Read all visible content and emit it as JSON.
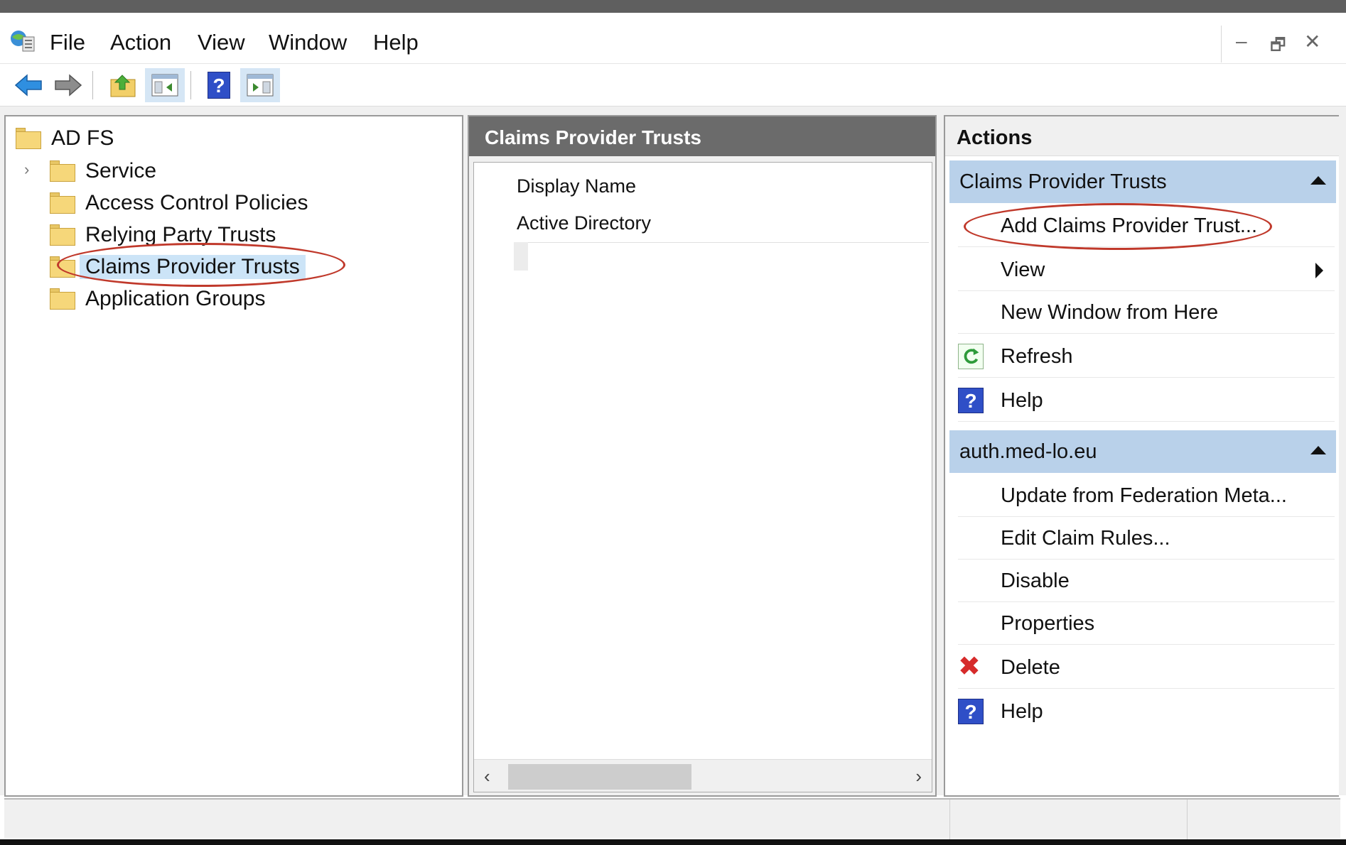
{
  "menu": {
    "items": [
      "File",
      "Action",
      "View",
      "Window",
      "Help"
    ]
  },
  "window_controls": {
    "minimize": "–",
    "restore": "🗗",
    "close": "✕"
  },
  "tree": {
    "root": "AD FS",
    "items": [
      {
        "label": "Service",
        "expandable": true
      },
      {
        "label": "Access Control Policies",
        "expandable": false
      },
      {
        "label": "Relying Party Trusts",
        "expandable": false
      },
      {
        "label": "Claims Provider Trusts",
        "expandable": false,
        "selected": true
      },
      {
        "label": "Application Groups",
        "expandable": false
      }
    ],
    "expander_glyph": "›"
  },
  "center": {
    "title": "Claims Provider Trusts",
    "column_header": "Display Name",
    "rows": [
      "Active Directory"
    ],
    "scroll_left": "‹",
    "scroll_right": "›"
  },
  "actions": {
    "title": "Actions",
    "sections": [
      {
        "title": "Claims Provider Trusts",
        "items": [
          {
            "label": "Add Claims Provider Trust...",
            "icon": ""
          },
          {
            "label": "View",
            "icon": "",
            "submenu": true
          },
          {
            "label": "New Window from Here",
            "icon": ""
          },
          {
            "label": "Refresh",
            "icon": "refresh-icon"
          },
          {
            "label": "Help",
            "icon": "help-icon"
          }
        ]
      },
      {
        "title": "auth.med-lo.eu",
        "items": [
          {
            "label": "Update from Federation Meta...",
            "icon": ""
          },
          {
            "label": "Edit Claim Rules...",
            "icon": ""
          },
          {
            "label": "Disable",
            "icon": ""
          },
          {
            "label": "Properties",
            "icon": ""
          },
          {
            "label": "Delete",
            "icon": "delete-icon"
          },
          {
            "label": "Help",
            "icon": "help-icon"
          }
        ]
      }
    ]
  },
  "icons": {
    "help_glyph": "?",
    "delete_glyph": "✖"
  },
  "colors": {
    "section_header": "#b9d1ea",
    "selection": "#cce4f7",
    "annotation": "#c0392b",
    "help_icon": "#2f4fc7",
    "delete_icon": "#d62b2b"
  }
}
